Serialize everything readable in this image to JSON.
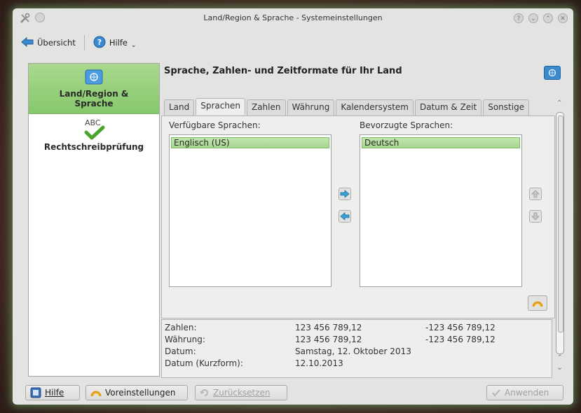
{
  "window": {
    "title": "Land/Region & Sprache - Systemeinstellungen"
  },
  "toolbar": {
    "overview_label": "Übersicht",
    "help_label": "Hilfe"
  },
  "sidebar": {
    "items": [
      {
        "label": "Land/Region & Sprache",
        "icon": "flag-icon",
        "selected": true
      },
      {
        "label": "Rechtschreibprüfung",
        "icon": "spellcheck-icon",
        "icon_text": "ABC",
        "selected": false
      }
    ]
  },
  "main": {
    "title": "Sprache, Zahlen- und Zeitformate für Ihr Land",
    "tabs": [
      {
        "label": "Land"
      },
      {
        "label": "Sprachen",
        "active": true
      },
      {
        "label": "Zahlen"
      },
      {
        "label": "Währung"
      },
      {
        "label": "Kalendersystem"
      },
      {
        "label": "Datum & Zeit"
      },
      {
        "label": "Sonstige"
      }
    ],
    "available_label": "Verfügbare Sprachen:",
    "available_languages": [
      "Englisch (US)"
    ],
    "preferred_label": "Bevorzugte Sprachen:",
    "preferred_languages": [
      "Deutsch"
    ]
  },
  "preview": {
    "rows": [
      {
        "label": "Zahlen:",
        "positive": "123 456 789,12",
        "negative": "-123 456 789,12"
      },
      {
        "label": "Währung:",
        "positive": "123 456 789,12",
        "negative": "-123 456 789,12"
      },
      {
        "label": "Datum:",
        "positive": "Samstag, 12. Oktober 2013",
        "negative": ""
      },
      {
        "label": "Datum (Kurzform):",
        "positive": "12.10.2013",
        "negative": ""
      }
    ]
  },
  "bottom": {
    "help_label": "Hilfe",
    "defaults_label": "Voreinstellungen",
    "reset_label": "Zurücksetzen",
    "apply_label": "Anwenden"
  },
  "colors": {
    "selection_green": "#a6d68f",
    "window_bg": "#e3e4e2",
    "accent_blue": "#3a8ad0"
  }
}
